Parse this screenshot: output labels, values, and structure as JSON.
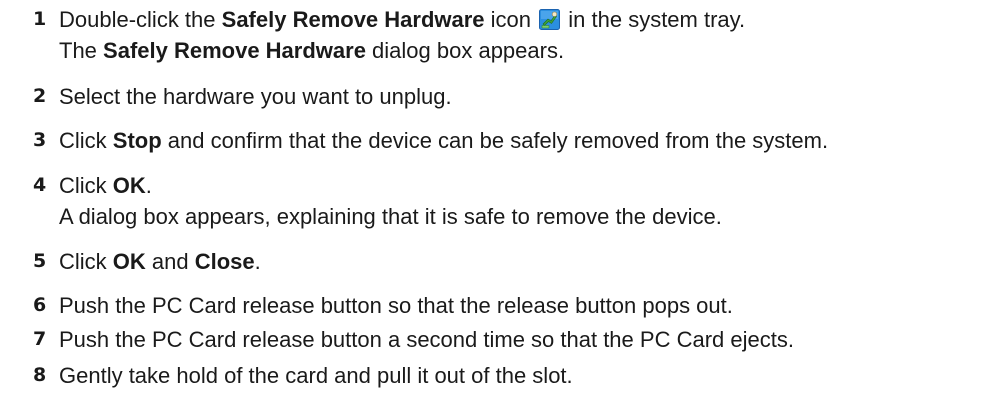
{
  "steps": [
    {
      "number": "1",
      "line1": {
        "pre": "Double-click the ",
        "bold": "Safely Remove Hardware",
        "mid": " icon",
        "icon": "safely-remove-hardware-icon",
        "post": " in the system tray."
      },
      "line2": {
        "pre": "The ",
        "bold": "Safely Remove Hardware",
        "post": " dialog box appears."
      }
    },
    {
      "number": "2",
      "text": "Select the hardware you want to unplug."
    },
    {
      "number": "3",
      "pre": "Click ",
      "bold": "Stop",
      "post": " and confirm that the device can be safely removed from the system."
    },
    {
      "number": "4",
      "pre": "Click ",
      "bold": "OK",
      "post": ".",
      "line2": "A dialog box appears, explaining that it is safe to remove the device."
    },
    {
      "number": "5",
      "pre": "Click ",
      "bold1": "OK",
      "mid": " and ",
      "bold2": "Close",
      "post": "."
    },
    {
      "number": "6",
      "text": "Push the PC Card release button so that the release button pops out."
    },
    {
      "number": "7",
      "text": "Push the PC Card release button a second time so that the PC Card ejects."
    },
    {
      "number": "8",
      "text": "Gently take hold of the card and pull it out of the slot."
    }
  ]
}
